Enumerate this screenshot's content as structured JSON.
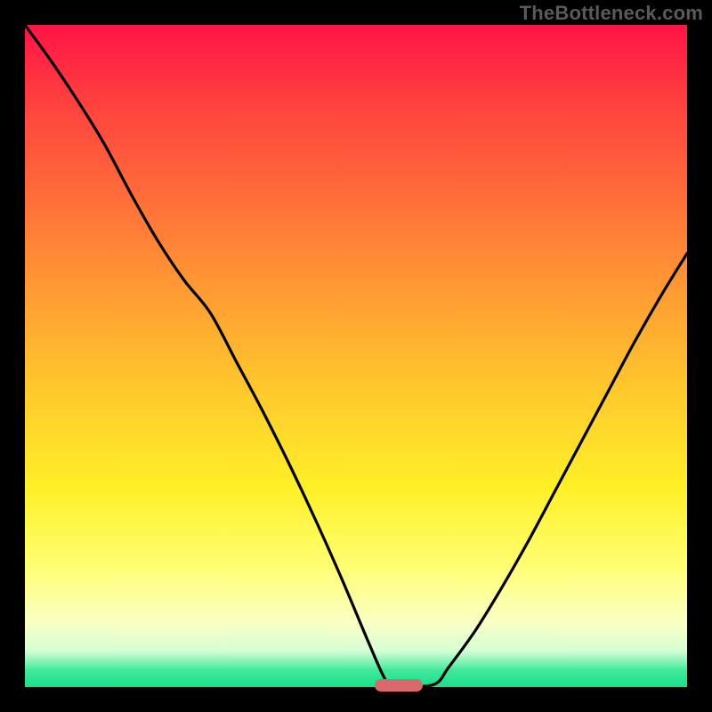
{
  "watermark": "TheBottleneck.com",
  "frame": {
    "border_px": 28,
    "border_color": "#000000"
  },
  "gradient_stops": [
    {
      "offset": 0.0,
      "color": "#ff1346"
    },
    {
      "offset": 0.1,
      "color": "#ff3b3f"
    },
    {
      "offset": 0.25,
      "color": "#ff6a3a"
    },
    {
      "offset": 0.4,
      "color": "#ff9a33"
    },
    {
      "offset": 0.55,
      "color": "#ffc82d"
    },
    {
      "offset": 0.7,
      "color": "#fff028"
    },
    {
      "offset": 0.82,
      "color": "#ffff75"
    },
    {
      "offset": 0.9,
      "color": "#fbffc2"
    },
    {
      "offset": 0.945,
      "color": "#d6ffd6"
    },
    {
      "offset": 0.96,
      "color": "#8cf5b8"
    },
    {
      "offset": 0.975,
      "color": "#3fe89a"
    },
    {
      "offset": 1.0,
      "color": "#19e08a"
    }
  ],
  "marker": {
    "x_frac": 0.565,
    "width_frac": 0.073,
    "color": "#d86a6d"
  },
  "chart_data": {
    "type": "line",
    "title": "",
    "xlabel": "",
    "ylabel": "",
    "xlim": [
      0,
      1
    ],
    "ylim": [
      0,
      1
    ],
    "x": [
      0.0,
      0.04,
      0.08,
      0.12,
      0.16,
      0.2,
      0.24,
      0.28,
      0.32,
      0.36,
      0.4,
      0.44,
      0.48,
      0.52,
      0.545,
      0.56,
      0.58,
      0.62,
      0.64,
      0.68,
      0.72,
      0.76,
      0.8,
      0.84,
      0.88,
      0.92,
      0.96,
      1.0
    ],
    "series": [
      {
        "name": "curve",
        "values": [
          1.0,
          0.945,
          0.885,
          0.82,
          0.745,
          0.675,
          0.615,
          0.565,
          0.49,
          0.415,
          0.335,
          0.25,
          0.16,
          0.065,
          0.01,
          0.0,
          0.0,
          0.005,
          0.03,
          0.085,
          0.15,
          0.22,
          0.295,
          0.37,
          0.445,
          0.52,
          0.59,
          0.655
        ]
      }
    ],
    "annotations": [
      {
        "type": "segment",
        "x0": 0.528,
        "x1": 0.601,
        "y": 0.0,
        "label": "optimal-range"
      }
    ]
  }
}
